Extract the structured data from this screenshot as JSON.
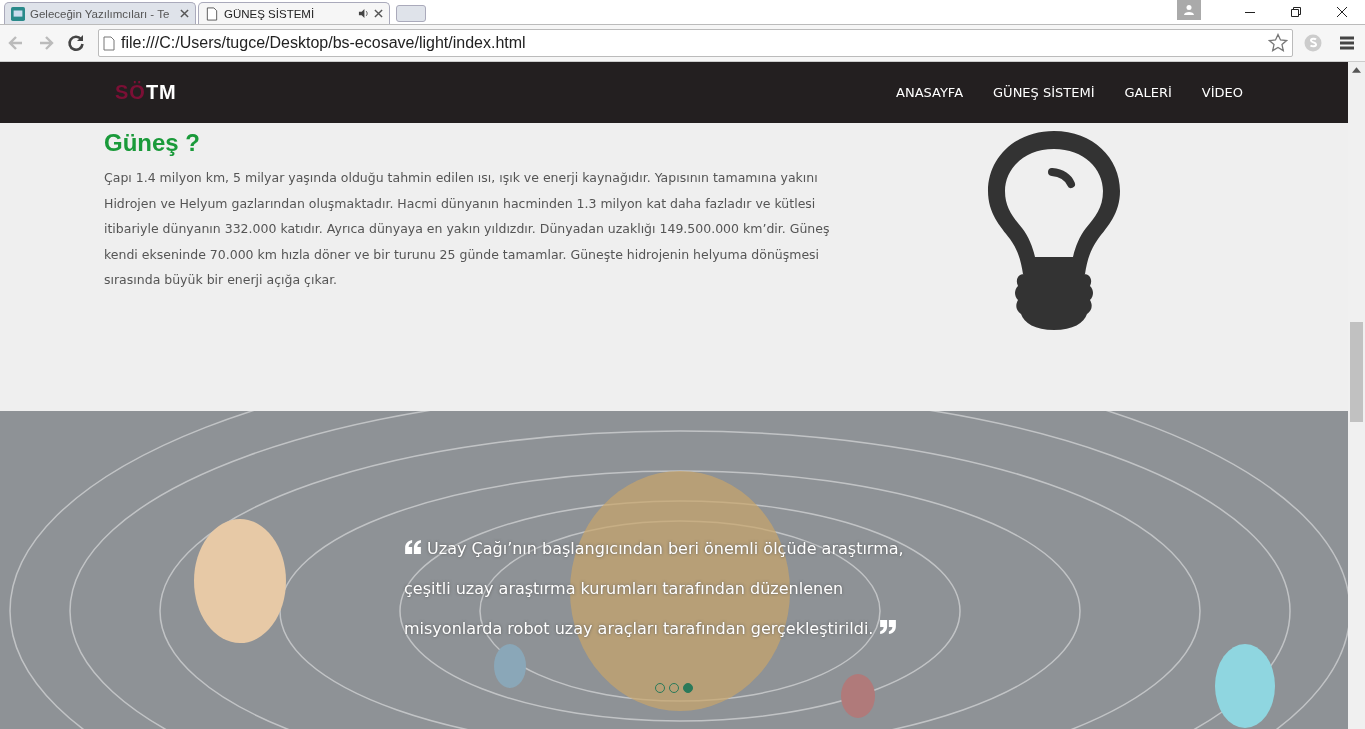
{
  "browser": {
    "tabs": [
      {
        "title": "Geleceğin Yazılımcıları - Te",
        "selected": false,
        "kind": "app",
        "audio": false
      },
      {
        "title": "GÜNEŞ SİSTEMİ",
        "selected": true,
        "kind": "page",
        "audio": true
      }
    ],
    "url": "file:///C:/Users/tugce/Desktop/bs-ecosave/light/index.html"
  },
  "navbar": {
    "logo": [
      {
        "text": "SÖ",
        "color": "#7b0f35"
      },
      {
        "text": "TM",
        "color": "#ffffff"
      }
    ],
    "items": [
      "ANASAYFA",
      "GÜNEŞ SİSTEMİ",
      "GALERİ",
      "VİDEO"
    ]
  },
  "section": {
    "title": "Güneş ?",
    "text": "Çapı 1.4 milyon km, 5 milyar yaşında olduğu tahmin edilen ısı, ışık ve enerji kaynağıdır. Yapısının tamamına yakını Hidrojen ve Helyum gazlarından oluşmaktadır. Hacmi dünyanın hacminden 1.3 milyon kat daha fazladır ve kütlesi itibariyle dünyanın 332.000 katıdır. Ayrıca dünyaya en yakın yıldızdır. Dünyadan uzaklığı 149.500.000 km’dir. Güneş kendi ekseninde 70.000 km hızla döner ve bir turunu 25 günde tamamlar. Güneşte hidrojenin helyuma dönüşmesi sırasında büyük bir enerji açığa çıkar."
  },
  "banner": {
    "quote": "Uzay Çağı’nın başlangıcından beri önemli ölçüde araştırma, çeşitli uzay araştırma kurumları tarafından düzenlenen misyonlarda robot uzay araçları tarafından gerçekleştirildi.",
    "dots": [
      {
        "selected": false
      },
      {
        "selected": false
      },
      {
        "selected": true
      }
    ]
  }
}
